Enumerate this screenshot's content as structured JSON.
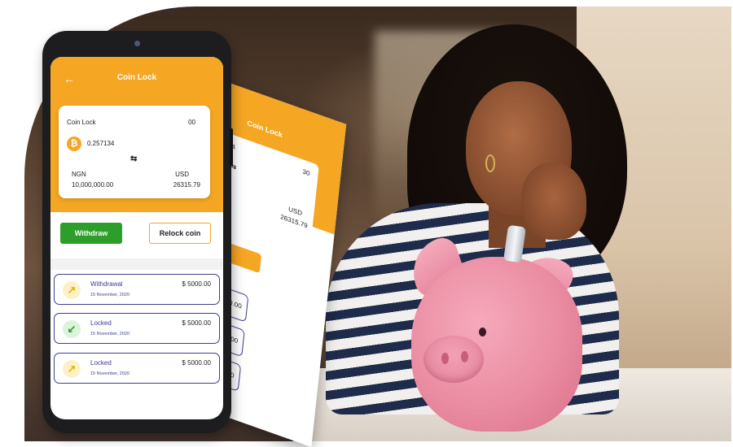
{
  "app": {
    "title": "Coin Lock",
    "card": {
      "label": "Coin Lock",
      "count": "00",
      "btc_amount": "0.257134",
      "ngn_label": "NGN",
      "ngn_value": "10,000,000.00",
      "usd_label": "USD",
      "usd_value": "26315.79"
    },
    "buttons": {
      "withdraw": "Withdraw",
      "relock": "Relock coin"
    },
    "transactions": [
      {
        "type": "Withdrawal",
        "date": "15 November, 2020",
        "amount": "$ 5000.00",
        "direction": "up"
      },
      {
        "type": "Locked",
        "date": "15 November, 2020",
        "amount": "$ 5000.00",
        "direction": "down"
      },
      {
        "type": "Locked",
        "date": "15 November, 2020",
        "amount": "$ 5000.00",
        "direction": "up"
      }
    ]
  },
  "second_phone": {
    "title": "Coin Lock",
    "card_count": "30",
    "card_fragment": "34",
    "usd_label": "USD",
    "usd_value": "26315.79",
    "row_amounts": [
      "$ 5000.00",
      "5000.00",
      "000.00"
    ]
  },
  "icons": {
    "back": "arrow-left-icon",
    "coin": "bitcoin-icon",
    "swap": "swap-icon",
    "outgoing": "arrow-up-right-icon",
    "incoming": "arrow-down-left-icon"
  },
  "colors": {
    "accent": "#f5a623",
    "withdraw_green": "#2e9e2b",
    "row_border": "#3b3f8f"
  }
}
